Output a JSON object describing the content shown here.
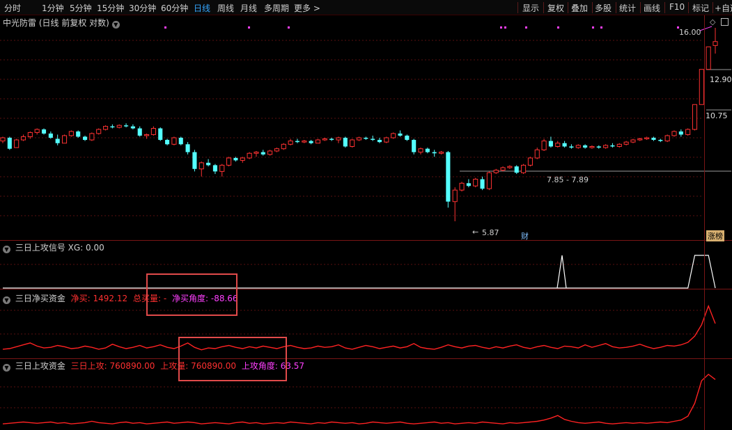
{
  "toolbar": {
    "periods": [
      "分时",
      "1分钟",
      "5分钟",
      "15分钟",
      "30分钟",
      "60分钟",
      "日线",
      "周线",
      "月线",
      "多周期",
      "更多 >"
    ],
    "active_period": "日线",
    "right_buttons": [
      "显示",
      "复权",
      "叠加",
      "多股",
      "统计",
      "画线",
      "F10",
      "标记",
      "+自选"
    ]
  },
  "main_panel": {
    "stock_name": "中光防雷",
    "settings": "(日线 前复权 对数)",
    "price_labels": {
      "high": "16.00",
      "mid1": "12.90",
      "mid2": "10.75",
      "range": "7.85 - 7.89",
      "low": "5.87"
    },
    "badges": {
      "fin": "财",
      "limit_up": "涨榜"
    }
  },
  "panel1": {
    "title": "三日上攻信号",
    "xg": "XG: 0.00"
  },
  "panel2": {
    "title": "三日净买资金",
    "net_buy": "净买: 1492.12",
    "total_buy": "总买量: -",
    "angle": "净买角度: -88.66"
  },
  "panel3": {
    "title": "三日上攻资金",
    "attack": "三日上攻: 760890.00",
    "attack_vol": "上攻量: 760890.00",
    "attack_angle": "上攻角度: 63.57"
  },
  "colors": {
    "up": "#ff3232",
    "down": "#54ffff",
    "net_line": "#ff2222",
    "angle": "#ff40ff",
    "annotation": "#e14a4a"
  },
  "icons": {
    "panel_toggle": "chevron-down-icon",
    "window_restore": "window-icon"
  },
  "chart_data": {
    "type": "candlestick",
    "title": "中光防雷",
    "candles_ohlc": [
      [
        8.9,
        9.1,
        8.8,
        9.05
      ],
      [
        9.05,
        9.1,
        8.5,
        8.55
      ],
      [
        8.6,
        9.0,
        8.6,
        8.95
      ],
      [
        8.95,
        9.2,
        8.9,
        9.1
      ],
      [
        9.1,
        9.35,
        9.0,
        9.3
      ],
      [
        9.3,
        9.5,
        9.2,
        9.45
      ],
      [
        9.45,
        9.5,
        9.2,
        9.25
      ],
      [
        9.25,
        9.35,
        9.0,
        9.05
      ],
      [
        9.0,
        9.2,
        8.7,
        8.8
      ],
      [
        8.8,
        9.2,
        8.8,
        9.15
      ],
      [
        9.15,
        9.4,
        9.1,
        9.35
      ],
      [
        9.35,
        9.4,
        9.05,
        9.1
      ],
      [
        9.1,
        9.15,
        8.9,
        8.95
      ],
      [
        8.95,
        9.3,
        8.9,
        9.25
      ],
      [
        9.25,
        9.5,
        9.2,
        9.45
      ],
      [
        9.45,
        9.65,
        9.4,
        9.6
      ],
      [
        9.6,
        9.7,
        9.5,
        9.55
      ],
      [
        9.55,
        9.7,
        9.5,
        9.65
      ],
      [
        9.65,
        9.75,
        9.55,
        9.6
      ],
      [
        9.6,
        9.7,
        9.45,
        9.5
      ],
      [
        9.5,
        9.6,
        9.1,
        9.15
      ],
      [
        9.15,
        9.25,
        9.0,
        9.2
      ],
      [
        9.2,
        9.6,
        9.15,
        9.5
      ],
      [
        9.5,
        9.55,
        8.9,
        8.95
      ],
      [
        8.95,
        9.0,
        8.7,
        8.75
      ],
      [
        8.75,
        9.1,
        8.7,
        9.05
      ],
      [
        9.05,
        9.1,
        8.7,
        8.75
      ],
      [
        8.75,
        8.85,
        8.3,
        8.4
      ],
      [
        8.4,
        8.5,
        7.6,
        7.7
      ],
      [
        7.7,
        8.0,
        7.4,
        7.95
      ],
      [
        7.95,
        8.1,
        7.8,
        7.85
      ],
      [
        7.85,
        7.9,
        7.5,
        7.6
      ],
      [
        7.6,
        7.9,
        7.4,
        7.85
      ],
      [
        7.85,
        8.2,
        7.8,
        8.15
      ],
      [
        8.15,
        8.2,
        8.0,
        8.05
      ],
      [
        8.05,
        8.2,
        7.95,
        8.15
      ],
      [
        8.15,
        8.4,
        8.1,
        8.35
      ],
      [
        8.35,
        8.45,
        8.2,
        8.4
      ],
      [
        8.4,
        8.5,
        8.25,
        8.3
      ],
      [
        8.3,
        8.5,
        8.25,
        8.45
      ],
      [
        8.45,
        8.6,
        8.4,
        8.55
      ],
      [
        8.55,
        8.8,
        8.5,
        8.75
      ],
      [
        8.75,
        9.0,
        8.7,
        8.9
      ],
      [
        8.9,
        9.0,
        8.8,
        8.85
      ],
      [
        8.85,
        8.95,
        8.8,
        8.9
      ],
      [
        8.9,
        8.95,
        8.75,
        8.8
      ],
      [
        8.8,
        9.0,
        8.8,
        8.95
      ],
      [
        8.95,
        9.05,
        8.9,
        9.0
      ],
      [
        9.0,
        9.05,
        8.9,
        8.95
      ],
      [
        8.95,
        9.1,
        8.8,
        9.05
      ],
      [
        9.05,
        9.1,
        8.6,
        8.65
      ],
      [
        8.65,
        9.0,
        8.6,
        8.95
      ],
      [
        8.95,
        9.1,
        8.9,
        9.05
      ],
      [
        9.05,
        9.1,
        8.95,
        9.0
      ],
      [
        9.0,
        9.15,
        8.9,
        8.95
      ],
      [
        8.95,
        9.05,
        8.8,
        8.85
      ],
      [
        8.85,
        9.1,
        8.8,
        9.05
      ],
      [
        9.05,
        9.3,
        9.0,
        9.25
      ],
      [
        9.25,
        9.4,
        9.1,
        9.15
      ],
      [
        9.15,
        9.2,
        8.9,
        8.95
      ],
      [
        8.95,
        9.0,
        8.3,
        8.4
      ],
      [
        8.4,
        8.6,
        8.3,
        8.55
      ],
      [
        8.55,
        8.6,
        8.35,
        8.4
      ],
      [
        8.4,
        8.5,
        8.2,
        8.35
      ],
      [
        8.35,
        8.45,
        8.3,
        8.4
      ],
      [
        8.4,
        8.45,
        6.3,
        6.5
      ],
      [
        6.5,
        7.0,
        5.87,
        6.9
      ],
      [
        6.9,
        7.2,
        6.85,
        7.15
      ],
      [
        7.15,
        7.3,
        7.0,
        7.05
      ],
      [
        7.05,
        7.35,
        7.0,
        7.3
      ],
      [
        7.3,
        7.4,
        6.9,
        6.95
      ],
      [
        6.95,
        7.6,
        6.9,
        7.55
      ],
      [
        7.55,
        7.7,
        7.5,
        7.65
      ],
      [
        7.65,
        7.8,
        7.6,
        7.75
      ],
      [
        7.75,
        7.85,
        7.7,
        7.8
      ],
      [
        7.8,
        7.85,
        7.5,
        7.55
      ],
      [
        7.55,
        7.9,
        7.5,
        7.85
      ],
      [
        7.85,
        8.2,
        7.8,
        8.15
      ],
      [
        8.15,
        8.6,
        8.1,
        8.5
      ],
      [
        8.5,
        9.0,
        8.45,
        8.9
      ],
      [
        8.9,
        9.1,
        8.6,
        8.65
      ],
      [
        8.65,
        8.9,
        8.6,
        8.8
      ],
      [
        8.8,
        8.9,
        8.6,
        8.65
      ],
      [
        8.65,
        8.75,
        8.55,
        8.6
      ],
      [
        8.6,
        8.75,
        8.55,
        8.7
      ],
      [
        8.7,
        8.75,
        8.55,
        8.6
      ],
      [
        8.6,
        8.7,
        8.55,
        8.65
      ],
      [
        8.65,
        8.7,
        8.55,
        8.6
      ],
      [
        8.6,
        8.75,
        8.55,
        8.7
      ],
      [
        8.7,
        8.8,
        8.6,
        8.65
      ],
      [
        8.65,
        8.8,
        8.6,
        8.75
      ],
      [
        8.75,
        8.9,
        8.7,
        8.85
      ],
      [
        8.85,
        9.0,
        8.8,
        8.95
      ],
      [
        8.95,
        9.05,
        8.9,
        9.0
      ],
      [
        9.0,
        9.1,
        8.95,
        9.05
      ],
      [
        9.05,
        9.1,
        8.9,
        8.95
      ],
      [
        8.95,
        9.0,
        8.85,
        8.9
      ],
      [
        8.9,
        9.2,
        8.85,
        9.15
      ],
      [
        9.15,
        9.4,
        9.1,
        9.35
      ],
      [
        9.35,
        9.45,
        9.1,
        9.2
      ],
      [
        9.2,
        9.5,
        9.15,
        9.45
      ],
      [
        9.45,
        10.75,
        9.4,
        10.75
      ],
      [
        10.75,
        12.9,
        10.75,
        12.9
      ],
      [
        12.9,
        14.5,
        12.9,
        14.5
      ],
      [
        14.6,
        16.0,
        14.0,
        14.9
      ]
    ],
    "panel1_xg": [
      0,
      0,
      0,
      0,
      0,
      0,
      0,
      0,
      0,
      0,
      0,
      0,
      0,
      0,
      0,
      0,
      0,
      0,
      0,
      0,
      0,
      0,
      0,
      0,
      0,
      0,
      0,
      0,
      0,
      0,
      0,
      0,
      0,
      0,
      0,
      0,
      0,
      0,
      0,
      0,
      0,
      0,
      0,
      0,
      0,
      0,
      0,
      0,
      0,
      0,
      0,
      0,
      0,
      0,
      0,
      0,
      0,
      0,
      0,
      0,
      0,
      0,
      0,
      0,
      0,
      0,
      0,
      0,
      0,
      0,
      0,
      0,
      0,
      0,
      0,
      0,
      0,
      0,
      0,
      0,
      0,
      0,
      0,
      0,
      0,
      0,
      0,
      0,
      0,
      0,
      0,
      0,
      0,
      0,
      0,
      0,
      0,
      0,
      0,
      0,
      0,
      1,
      1,
      1,
      0
    ],
    "panel2_net_buy": [
      0.9,
      1.0,
      1.3,
      1.6,
      1.9,
      1.4,
      1.1,
      1.2,
      1.5,
      1.3,
      1.0,
      1.1,
      1.4,
      1.2,
      0.9,
      1.1,
      1.7,
      1.3,
      1.0,
      1.2,
      1.5,
      1.1,
      1.3,
      1.6,
      1.2,
      1.0,
      1.4,
      1.9,
      1.2,
      0.8,
      1.1,
      1.0,
      1.3,
      1.5,
      1.2,
      1.0,
      1.3,
      1.1,
      1.4,
      1.2,
      1.0,
      1.3,
      1.5,
      1.2,
      1.0,
      1.1,
      1.4,
      1.2,
      1.3,
      1.6,
      1.1,
      0.9,
      1.2,
      1.5,
      1.3,
      1.0,
      1.2,
      1.4,
      1.1,
      1.3,
      1.8,
      1.2,
      1.0,
      0.9,
      1.2,
      1.6,
      1.3,
      1.1,
      1.4,
      1.5,
      1.2,
      1.0,
      1.3,
      1.1,
      1.4,
      1.6,
      1.2,
      1.0,
      1.3,
      1.5,
      1.2,
      1.0,
      1.4,
      1.3,
      1.1,
      1.6,
      1.2,
      1.5,
      1.8,
      1.3,
      1.1,
      1.2,
      1.4,
      1.7,
      1.3,
      1.0,
      1.2,
      1.5,
      1.4,
      1.6,
      2.0,
      3.0,
      4.8,
      7.8,
      5.0
    ],
    "panel3_attack": [
      0.3,
      0.4,
      0.5,
      0.6,
      0.5,
      0.4,
      0.5,
      0.6,
      0.4,
      0.5,
      0.3,
      0.4,
      0.5,
      0.7,
      0.5,
      0.4,
      0.3,
      0.5,
      0.6,
      0.4,
      0.5,
      0.3,
      0.4,
      0.5,
      0.6,
      0.4,
      0.5,
      0.6,
      0.5,
      0.3,
      0.4,
      0.5,
      0.4,
      0.3,
      0.5,
      0.6,
      0.4,
      0.5,
      0.3,
      0.4,
      0.5,
      0.4,
      0.6,
      0.5,
      0.4,
      0.3,
      0.5,
      0.4,
      0.6,
      0.5,
      0.4,
      0.5,
      0.3,
      0.4,
      0.6,
      0.5,
      0.4,
      0.5,
      0.6,
      0.4,
      0.3,
      0.4,
      0.5,
      0.6,
      0.4,
      0.5,
      0.3,
      0.4,
      0.5,
      0.4,
      0.6,
      0.5,
      0.4,
      0.3,
      0.5,
      0.4,
      0.5,
      0.6,
      0.7,
      0.9,
      1.2,
      1.6,
      1.0,
      0.7,
      0.5,
      0.4,
      0.5,
      0.6,
      0.4,
      0.3,
      0.4,
      0.5,
      0.4,
      0.5,
      0.4,
      0.5,
      0.6,
      0.5,
      0.7,
      0.9,
      1.5,
      3.5,
      7.0,
      8.0,
      7.2
    ]
  }
}
